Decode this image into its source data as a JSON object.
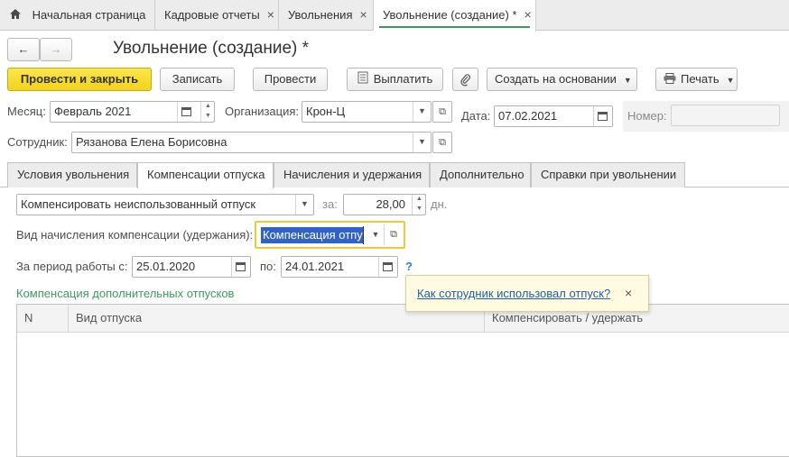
{
  "top_tabs": [
    {
      "label": "Начальная страница"
    },
    {
      "label": "Кадровые отчеты"
    },
    {
      "label": "Увольнения"
    },
    {
      "label": "Увольнение (создание) *"
    }
  ],
  "nav": {
    "back": "←",
    "forward": "→"
  },
  "doc_title": "Увольнение (создание) *",
  "toolbar": {
    "post_close": "Провести и закрыть",
    "save": "Записать",
    "post": "Провести",
    "pay": "Выплатить",
    "create_based": "Создать на основании",
    "print": "Печать"
  },
  "header": {
    "month_label": "Месяц:",
    "month_value": "Февраль 2021",
    "org_label": "Организация:",
    "org_value": "Крон-Ц",
    "date_label": "Дата:",
    "date_value": "07.02.2021",
    "number_label": "Номер:",
    "number_value": "",
    "employee_label": "Сотрудник:",
    "employee_value": "Рязанова Елена Борисовна"
  },
  "form_tabs": [
    {
      "label": "Условия увольнения"
    },
    {
      "label": "Компенсации отпуска"
    },
    {
      "label": "Начисления и удержания"
    },
    {
      "label": "Дополнительно"
    },
    {
      "label": "Справки при увольнении"
    }
  ],
  "compensation": {
    "mode_value": "Компенсировать неиспользованный отпуск",
    "for_label": "за:",
    "days_value": "28,00",
    "days_unit": "дн.",
    "accrual_label": "Вид начисления компенсации (удержания):",
    "accrual_value": "Компенсация отпуск",
    "period_label": "За период работы с:",
    "period_from": "25.01.2020",
    "period_to_label": "по:",
    "period_to": "24.01.2021",
    "help": "?"
  },
  "tooltip": {
    "link": "Как сотрудник использовал отпуск?",
    "close": "×"
  },
  "extra_section": {
    "title": "Компенсация дополнительных отпусков",
    "columns": [
      "N",
      "Вид отпуска",
      "Компенсировать / удержать"
    ]
  },
  "colors": {
    "accent_green": "#3c9a5f",
    "primary_yellow": "#f2d31b",
    "link_blue": "#1f5fa6"
  }
}
